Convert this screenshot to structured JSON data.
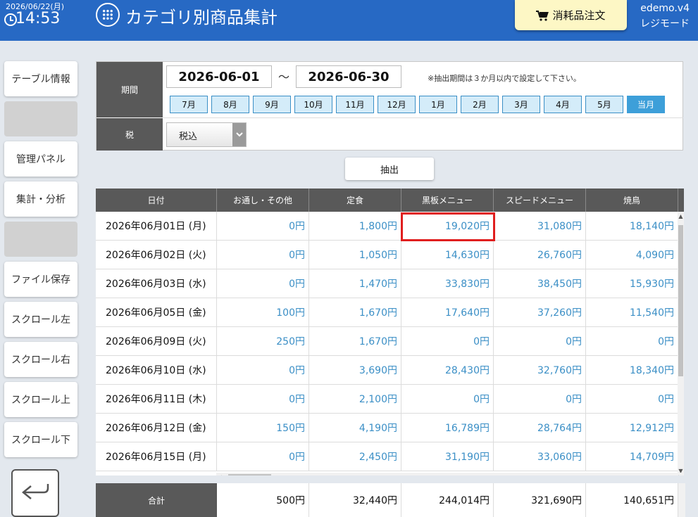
{
  "header": {
    "date": "2026/06/22(月)",
    "time": "14:53",
    "title": "カテゴリ別商品集計",
    "order_button": "消耗品注文",
    "brand": "edemo.v4",
    "mode": "レジモード"
  },
  "sidebar": {
    "items": [
      {
        "label": "テーブル情報"
      },
      {
        "label": ""
      },
      {
        "label": "管理パネル"
      },
      {
        "label": "集計・分析"
      },
      {
        "label": ""
      },
      {
        "label": "ファイル保存"
      },
      {
        "label": "スクロール左"
      },
      {
        "label": "スクロール右"
      },
      {
        "label": "スクロール上"
      },
      {
        "label": "スクロール下"
      }
    ]
  },
  "filter": {
    "period_label": "期間",
    "date_from": "2026-06-01",
    "tilde": "～",
    "date_to": "2026-06-30",
    "note": "※抽出期間は３か月以内で設定して下さい。",
    "months": [
      "7月",
      "8月",
      "9月",
      "10月",
      "11月",
      "12月",
      "1月",
      "2月",
      "3月",
      "4月",
      "5月",
      "当月"
    ],
    "active_month": "当月",
    "tax_label": "税",
    "tax_value": "税込"
  },
  "extract_button": "抽出",
  "table": {
    "headers": [
      "日付",
      "お通し・その他",
      "定食",
      "黒板メニュー",
      "スピードメニュー",
      "焼鳥"
    ],
    "rows": [
      [
        "2026年06月01日 (月)",
        "0円",
        "1,800円",
        "19,020円",
        "31,080円",
        "18,140円"
      ],
      [
        "2026年06月02日 (火)",
        "0円",
        "1,050円",
        "14,630円",
        "26,760円",
        "4,090円"
      ],
      [
        "2026年06月03日 (水)",
        "0円",
        "1,470円",
        "33,830円",
        "38,450円",
        "15,930円"
      ],
      [
        "2026年06月05日 (金)",
        "100円",
        "1,670円",
        "17,640円",
        "37,260円",
        "11,540円"
      ],
      [
        "2026年06月09日 (火)",
        "250円",
        "1,670円",
        "0円",
        "0円",
        "0円"
      ],
      [
        "2026年06月10日 (水)",
        "0円",
        "3,690円",
        "28,430円",
        "32,760円",
        "18,340円"
      ],
      [
        "2026年06月11日 (木)",
        "0円",
        "2,100円",
        "0円",
        "0円",
        "0円"
      ],
      [
        "2026年06月12日 (金)",
        "150円",
        "4,190円",
        "16,789円",
        "28,764円",
        "12,912円"
      ],
      [
        "2026年06月15日 (月)",
        "0円",
        "2,450円",
        "31,190円",
        "33,060円",
        "14,709円"
      ]
    ],
    "totals_label": "合計",
    "totals": [
      "500円",
      "32,440円",
      "244,014円",
      "321,690円",
      "140,651円"
    ]
  },
  "colors": {
    "header_bg": "#2769c4",
    "value_text": "#3b8fc6",
    "highlight": "#e01e1e",
    "active_month": "#3d9fd9"
  }
}
